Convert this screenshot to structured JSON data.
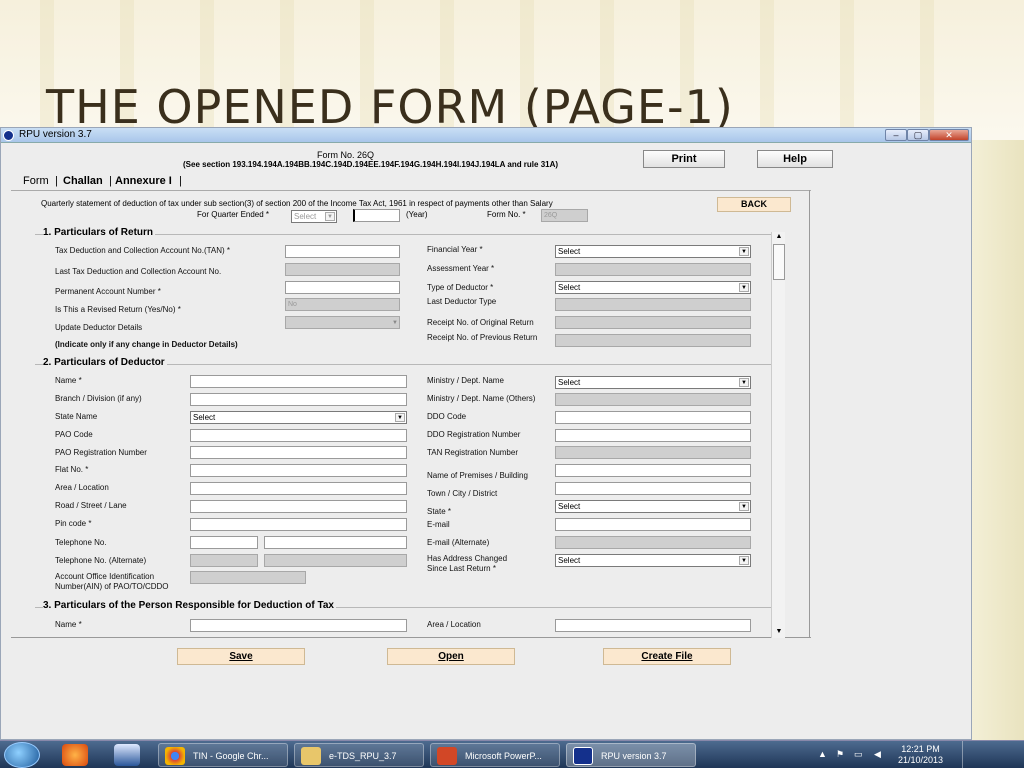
{
  "slide": {
    "title": "THE OPENED FORM (PAGE-1)"
  },
  "window": {
    "title": "RPU version 3.7",
    "min": "–",
    "max": "▢",
    "close": "✕"
  },
  "header": {
    "form_no": "Form No. 26Q",
    "section": "(See section 193.194.194A.194BB.194C.194D.194EE.194F.194G.194H.194I.194J.194LA and rule 31A)",
    "print": "Print",
    "help": "Help",
    "back": "BACK"
  },
  "tabs": [
    "Form",
    "Challan",
    "Annexure I"
  ],
  "statement": "Quarterly statement of deduction of tax under sub section(3) of section 200 of the Income Tax Act, 1961 in respect of payments other than Salary",
  "quarter": {
    "label": "For Quarter Ended  *",
    "select": "Select",
    "year_label": "(Year)",
    "formno_label": "Form No.  *",
    "formno_value": "26Q"
  },
  "sec1": {
    "title": "1. Particulars of Return",
    "tan": "Tax Deduction and Collection Account No.(TAN)  *",
    "last_tan": "Last Tax Deduction and Collection Account No.",
    "pan": "Permanent Account Number *",
    "revised": "Is This a Revised Return (Yes/No)  *",
    "revised_value": "No",
    "update": "Update Deductor Details",
    "indicate": "(Indicate only if any change in Deductor Details)",
    "fy": "Financial Year  *",
    "fy_value": "Select",
    "ay": "Assessment Year  *",
    "type": "Type of Deductor  *",
    "type_value": "Select",
    "last_type": "Last Deductor Type",
    "receipt_orig": "Receipt No. of Original Return",
    "receipt_prev": "Receipt No. of Previous Return"
  },
  "sec2": {
    "title": "2. Particulars of Deductor",
    "left": [
      "Name  *",
      "Branch / Division (if any)",
      "State Name",
      "PAO Code",
      "PAO Registration Number",
      "Flat No.  *",
      "Area / Location",
      "Road / Street / Lane",
      "Pin code  *",
      "Telephone No.",
      "Telephone No. (Alternate)",
      "Account Office Identification",
      "Number(AIN) of PAO/TO/CDDO"
    ],
    "state_value": "Select",
    "right": [
      "Ministry / Dept. Name",
      "Ministry / Dept. Name (Others)",
      "DDO Code",
      "DDO Registration Number",
      "TAN Registration Number",
      "Name of Premises / Building",
      "Town / City / District",
      "State  *",
      "E-mail",
      "E-mail (Alternate)",
      "Has Address Changed",
      "Since Last Return  *"
    ],
    "ministry_value": "Select",
    "state2_value": "Select",
    "changed_value": "Select"
  },
  "sec3": {
    "title": "3. Particulars of the Person Responsible for Deduction of Tax",
    "name": "Name  *",
    "area": "Area / Location"
  },
  "actions": {
    "save": "Save",
    "open": "Open",
    "create": "Create File"
  },
  "taskbar": {
    "items": [
      "TIN - Google Chr...",
      "e-TDS_RPU_3.7",
      "Microsoft PowerP...",
      "RPU version 3.7"
    ],
    "time": "12:21 PM",
    "date": "21/10/2013"
  }
}
